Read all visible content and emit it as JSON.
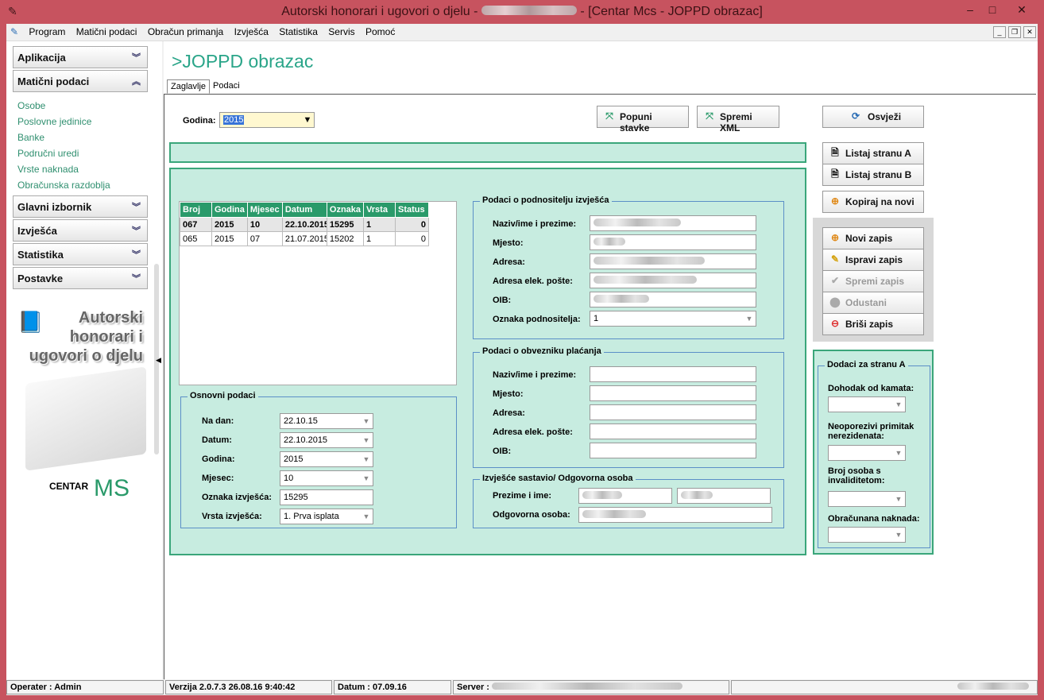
{
  "window": {
    "title_prefix": "Autorski honorari i ugovori o djelu -",
    "title_suffix": "- [Centar Mcs - JOPPD obrazac]",
    "min": "–",
    "max": "□",
    "close": "✕"
  },
  "menu": [
    "Program",
    "Matični podaci",
    "Obračun primanja",
    "Izvješća",
    "Statistika",
    "Servis",
    "Pomoć"
  ],
  "sidebar": {
    "groups": {
      "aplikacija": "Aplikacija",
      "maticni": "Matični podaci",
      "glavni": "Glavni izbornik",
      "izvjesca": "Izvješća",
      "statistika": "Statistika",
      "postavke": "Postavke"
    },
    "links": [
      "Osobe",
      "Poslovne jedinice",
      "Banke",
      "Područni uredi",
      "Vrste naknada",
      "Obračunska razdoblja"
    ],
    "promo": [
      "Autorski",
      "honorari i",
      "ugovori o djelu"
    ],
    "logo": "CENTAR MCS"
  },
  "main": {
    "title": ">JOPPD obrazac",
    "tabs": [
      "Zaglavlje",
      "Podaci"
    ],
    "godina_label": "Godina:",
    "godina_value": "2015",
    "buttons": {
      "popuni": "Popuni stavke",
      "spremi_xml": "Spremi XML",
      "osvjezi": "Osvježi",
      "listaj_a": "Listaj stranu A",
      "listaj_b": "Listaj stranu B",
      "kopiraj": "Kopiraj na novi",
      "novi": "Novi zapis",
      "ispravi": "Ispravi zapis",
      "spremi": "Spremi zapis",
      "odustani": "Odustani",
      "brisi": "Briši zapis"
    },
    "table": {
      "headers": [
        "Broj",
        "Godina",
        "Mjesec",
        "Datum",
        "Oznaka",
        "Vrsta",
        "Status"
      ],
      "rows": [
        [
          "067",
          "2015",
          "10",
          "22.10.2015",
          "15295",
          "1",
          "0"
        ],
        [
          "065",
          "2015",
          "07",
          "21.07.2015",
          "15202",
          "1",
          "0"
        ]
      ]
    },
    "osnovni": {
      "title": "Osnovni podaci",
      "fields": [
        {
          "label": "Na dan:",
          "value": "22.10.15"
        },
        {
          "label": "Datum:",
          "value": "22.10.2015"
        },
        {
          "label": "Godina:",
          "value": "2015"
        },
        {
          "label": "Mjesec:",
          "value": "10"
        },
        {
          "label": "Oznaka izvješća:",
          "value": "15295"
        },
        {
          "label": "Vrsta izvješća:",
          "value": "1. Prva isplata"
        }
      ]
    },
    "podnositelj": {
      "title": "Podaci o podnositelju izvješća",
      "labels": [
        "Naziv/ime i prezime:",
        "Mjesto:",
        "Adresa:",
        "Adresa elek. pošte:",
        "OIB:",
        "Oznaka podnositelja:"
      ],
      "oznaka_value": "1"
    },
    "obveznik": {
      "title": "Podaci o obvezniku plaćanja",
      "labels": [
        "Naziv/ime i prezime:",
        "Mjesto:",
        "Adresa:",
        "Adresa elek. pošte:",
        "OIB:"
      ]
    },
    "sastavio": {
      "title": "Izvješće sastavio/ Odgovorna osoba",
      "labels": [
        "Prezime i ime:",
        "Odgovorna osoba:"
      ]
    },
    "dodaci": {
      "title": "Dodaci za stranu A",
      "labels": [
        "Dohodak od kamata:",
        "Neoporezivi primitak nerezidenata:",
        "Broj osoba s invaliditetom:",
        "Obračunana naknada:"
      ]
    }
  },
  "status": {
    "operater": "Operater :  Admin",
    "verzija": "Verzija 2.0.7.3   26.08.16 9:40:42",
    "datum": "Datum  :  07.09.16",
    "server": "Server :"
  }
}
